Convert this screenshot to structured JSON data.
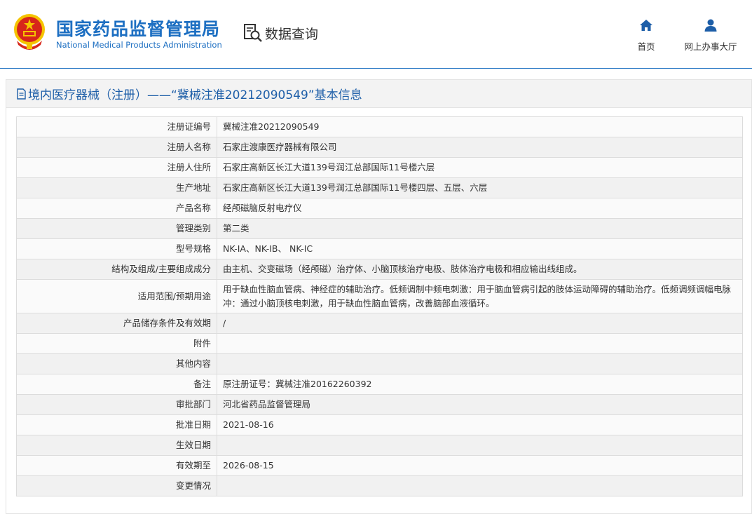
{
  "header": {
    "logo_cn": "国家药品监督管理局",
    "logo_en": "National Medical Products Administration",
    "query_label": "数据查询",
    "nav": {
      "home_label": "首页",
      "hall_label": "网上办事大厅"
    }
  },
  "panel": {
    "title": "境内医疗器械（注册）——“冀械注准20212090549”基本信息"
  },
  "rows": [
    {
      "label": "注册证编号",
      "value": "冀械注准20212090549"
    },
    {
      "label": "注册人名称",
      "value": "石家庄渡康医疗器械有限公司"
    },
    {
      "label": "注册人住所",
      "value": "石家庄高新区长江大道139号润江总部国际11号楼六层"
    },
    {
      "label": "生产地址",
      "value": "石家庄高新区长江大道139号润江总部国际11号楼四层、五层、六层"
    },
    {
      "label": "产品名称",
      "value": "经颅磁脑反射电疗仪"
    },
    {
      "label": "管理类别",
      "value": "第二类"
    },
    {
      "label": "型号规格",
      "value": "NK-IA、NK-IB、 NK-IC"
    },
    {
      "label": "结构及组成/主要组成成分",
      "value": "由主机、交变磁场（经颅磁）治疗体、小脑顶核治疗电极、肢体治疗电极和相应输出线组成。"
    },
    {
      "label": "适用范围/预期用途",
      "value": "用于缺血性脑血管病、神经症的辅助治疗。低频调制中频电刺激：用于脑血管病引起的肢体运动障碍的辅助治疗。低频调频调幅电脉冲：通过小脑顶核电刺激，用于缺血性脑血管病，改善脑部血液循环。"
    },
    {
      "label": "产品储存条件及有效期",
      "value": "/"
    },
    {
      "label": "附件",
      "value": ""
    },
    {
      "label": "其他内容",
      "value": ""
    },
    {
      "label": "备注",
      "value": "原注册证号：冀械注准20162260392"
    },
    {
      "label": "审批部门",
      "value": "河北省药品监督管理局"
    },
    {
      "label": "批准日期",
      "value": "2021-08-16"
    },
    {
      "label": "生效日期",
      "value": ""
    },
    {
      "label": "有效期至",
      "value": "2026-08-15"
    },
    {
      "label": "变更情况",
      "value": ""
    }
  ],
  "colors": {
    "brand_blue": "#1d6fc2",
    "title_blue": "#1d5ea8",
    "emblem_red": "#d7261b",
    "emblem_gold": "#f5c400"
  },
  "icons": {
    "emblem": "national-emblem-icon",
    "query": "document-search-icon",
    "home": "home-icon",
    "hall": "user-icon",
    "title": "document-icon"
  }
}
